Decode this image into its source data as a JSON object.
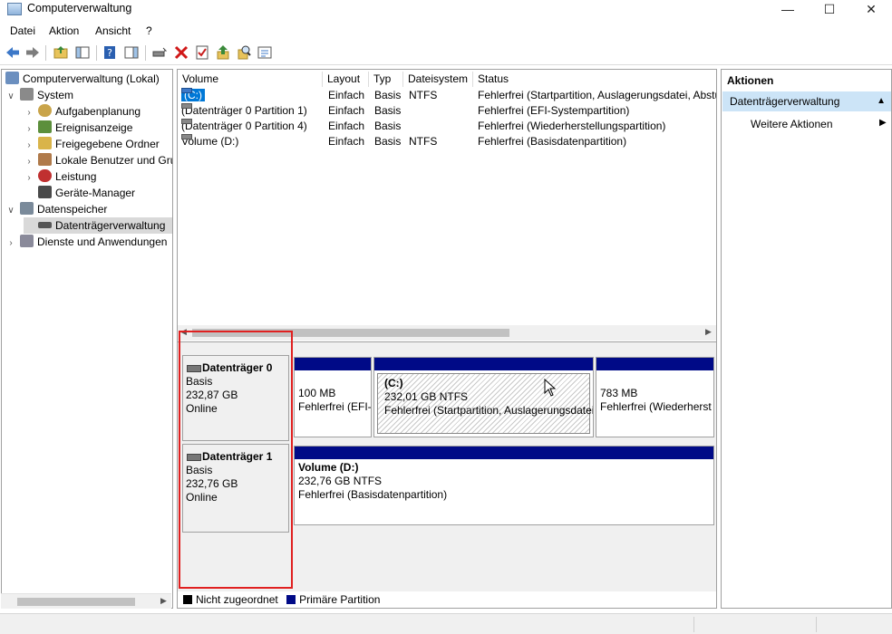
{
  "window": {
    "title": "Computerverwaltung",
    "minimize": "—",
    "maximize": "☐",
    "close": "✕"
  },
  "menu": [
    "Datei",
    "Aktion",
    "Ansicht",
    "?"
  ],
  "tree": {
    "items": [
      {
        "label": "Computerverwaltung (Lokal)",
        "icon": "computer-icon",
        "color": "#6b8fbf"
      },
      {
        "label": "System",
        "icon": "tools-icon",
        "color": "#8a8a8a"
      },
      {
        "label": "Aufgabenplanung",
        "icon": "clock-icon",
        "color": "#c9a44a"
      },
      {
        "label": "Ereignisanzeige",
        "icon": "event-viewer-icon",
        "color": "#5c8f3c"
      },
      {
        "label": "Freigegebene Ordner",
        "icon": "shared-folder-icon",
        "color": "#d9b44a"
      },
      {
        "label": "Lokale Benutzer und Gru",
        "icon": "users-icon",
        "color": "#b07a4a"
      },
      {
        "label": "Leistung",
        "icon": "performance-icon",
        "color": "#c03030"
      },
      {
        "label": "Geräte-Manager",
        "icon": "device-manager-icon",
        "color": "#4a4a4a"
      },
      {
        "label": "Datenspeicher",
        "icon": "storage-icon",
        "color": "#7a8a9a"
      },
      {
        "label": "Datenträgerverwaltung",
        "icon": "disk-management-icon",
        "color": "#555555"
      },
      {
        "label": "Dienste und Anwendungen",
        "icon": "services-icon",
        "color": "#8a8a9a"
      }
    ]
  },
  "table": {
    "columns": [
      "Volume",
      "Layout",
      "Typ",
      "Dateisystem",
      "Status"
    ],
    "rows": [
      {
        "volume": "(C:)",
        "layout": "Einfach",
        "typ": "Basis",
        "fs": "NTFS",
        "status": "Fehlerfrei (Startpartition, Auslagerungsdatei, Absturz"
      },
      {
        "volume": "(Datenträger 0 Partition 1)",
        "layout": "Einfach",
        "typ": "Basis",
        "fs": "",
        "status": "Fehlerfrei (EFI-Systempartition)"
      },
      {
        "volume": "(Datenträger 0 Partition 4)",
        "layout": "Einfach",
        "typ": "Basis",
        "fs": "",
        "status": "Fehlerfrei (Wiederherstellungspartition)"
      },
      {
        "volume": "Volume (D:)",
        "layout": "Einfach",
        "typ": "Basis",
        "fs": "NTFS",
        "status": "Fehlerfrei (Basisdatenpartition)"
      }
    ]
  },
  "disks": [
    {
      "name": "Datenträger 0",
      "type": "Basis",
      "size": "232,87 GB",
      "state": "Online",
      "partitions": [
        {
          "title": "",
          "line1": "100 MB",
          "line2": "Fehlerfrei (EFI-"
        },
        {
          "title": "(C:)",
          "line1": "232,01 GB NTFS",
          "line2": "Fehlerfrei (Startpartition, Auslagerungsdatei"
        },
        {
          "title": "",
          "line1": "783 MB",
          "line2": "Fehlerfrei (Wiederherst"
        }
      ]
    },
    {
      "name": "Datenträger 1",
      "type": "Basis",
      "size": "232,76 GB",
      "state": "Online",
      "partitions": [
        {
          "title": "Volume  (D:)",
          "line1": "232,76 GB NTFS",
          "line2": "Fehlerfrei (Basisdatenpartition)"
        }
      ]
    }
  ],
  "legend": [
    {
      "label": "Nicht zugeordnet",
      "color": "#000000"
    },
    {
      "label": "Primäre Partition",
      "color": "#000a87"
    }
  ],
  "actions": {
    "title": "Aktionen",
    "section": "Datenträgerverwaltung",
    "more": "Weitere Aktionen"
  }
}
